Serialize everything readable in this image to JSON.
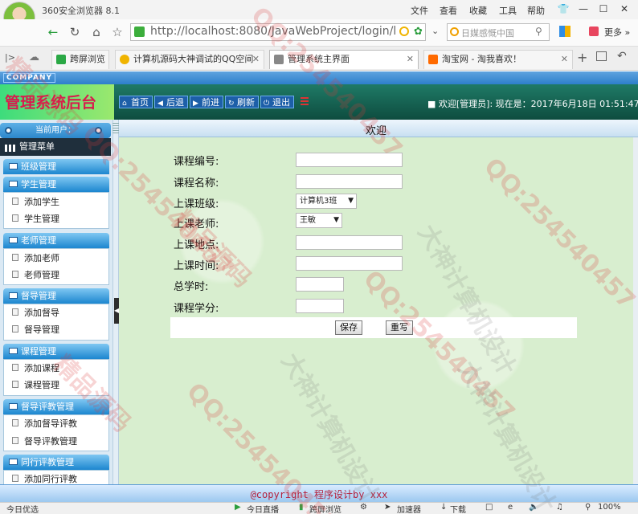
{
  "browser": {
    "title": "360安全浏览器 8.1",
    "menu": [
      "文件",
      "查看",
      "收藏",
      "工具",
      "帮助"
    ],
    "window_buttons": [
      "👕",
      "—",
      "☐",
      "✕"
    ],
    "url": "http://localhost:8080/JavaWebProject/login/lo",
    "search_placeholder": "日媒感慨中国",
    "more_label": "更多 »",
    "tabs": [
      {
        "label": "跨屏浏览",
        "icon": "phone-icon",
        "color": "#2aa845"
      },
      {
        "label": "计算机源码大神调试的QQ空间",
        "icon": "star-icon",
        "color": "#f0b400"
      },
      {
        "label": "管理系统主界面",
        "icon": "page-icon",
        "color": "#555555"
      },
      {
        "label": "淘宝网 - 淘我喜欢！",
        "icon": "taobao-icon",
        "color": "#ff6a00"
      }
    ]
  },
  "app": {
    "company": "COMPANY",
    "title": "管理系统后台",
    "nav_buttons": [
      {
        "label": "首页",
        "icon": "home-icon",
        "glyph": "⌂"
      },
      {
        "label": "后退",
        "icon": "back-icon",
        "glyph": "◀"
      },
      {
        "label": "前进",
        "icon": "forward-icon",
        "glyph": "▶"
      },
      {
        "label": "刷新",
        "icon": "refresh-icon",
        "glyph": "↻"
      },
      {
        "label": "退出",
        "icon": "power-icon",
        "glyph": "⏻"
      }
    ],
    "welcome": "■ 欢迎[管理员]:  现在是：2017年6月18日 01:51:47"
  },
  "sidebar": {
    "current_user": "当前用户：",
    "main_menu": "管理菜单",
    "sections": [
      {
        "title": "班级管理",
        "items": []
      },
      {
        "title": "学生管理",
        "items": [
          "添加学生",
          "学生管理"
        ]
      },
      {
        "title": "老师管理",
        "items": [
          "添加老师",
          "老师管理"
        ]
      },
      {
        "title": "督导管理",
        "items": [
          "添加督导",
          "督导管理"
        ]
      },
      {
        "title": "课程管理",
        "items": [
          "添加课程",
          "课程管理"
        ]
      },
      {
        "title": "督导评教管理",
        "items": [
          "添加督导评教",
          "督导评教管理"
        ]
      },
      {
        "title": "同行评教管理",
        "items": [
          "添加同行评教"
        ]
      }
    ]
  },
  "content": {
    "title": "欢迎",
    "fields": [
      {
        "label": "课程编号:",
        "type": "text",
        "value": ""
      },
      {
        "label": "课程名称:",
        "type": "text",
        "value": ""
      },
      {
        "label": "上课班级:",
        "type": "select",
        "value": "计算机3班"
      },
      {
        "label": "上课老师:",
        "type": "select",
        "value": "王敏"
      },
      {
        "label": "上课地点:",
        "type": "text",
        "value": ""
      },
      {
        "label": "上课时间:",
        "type": "text",
        "value": ""
      },
      {
        "label": "总学时:",
        "type": "text",
        "value": ""
      },
      {
        "label": "课程学分:",
        "type": "text",
        "value": ""
      }
    ],
    "save_label": "保存",
    "reset_label": "重写"
  },
  "footer": {
    "text": "@copyright  程序设计by xxx"
  },
  "statusbar": {
    "left": "今日优选",
    "items": [
      "今日直播",
      "跨屏浏览",
      "加速器",
      "下载"
    ],
    "zoom": "100%"
  },
  "watermark": {
    "qq": "QQ:254540457",
    "words": "大神计算机设计",
    "words2": "精品源码"
  }
}
